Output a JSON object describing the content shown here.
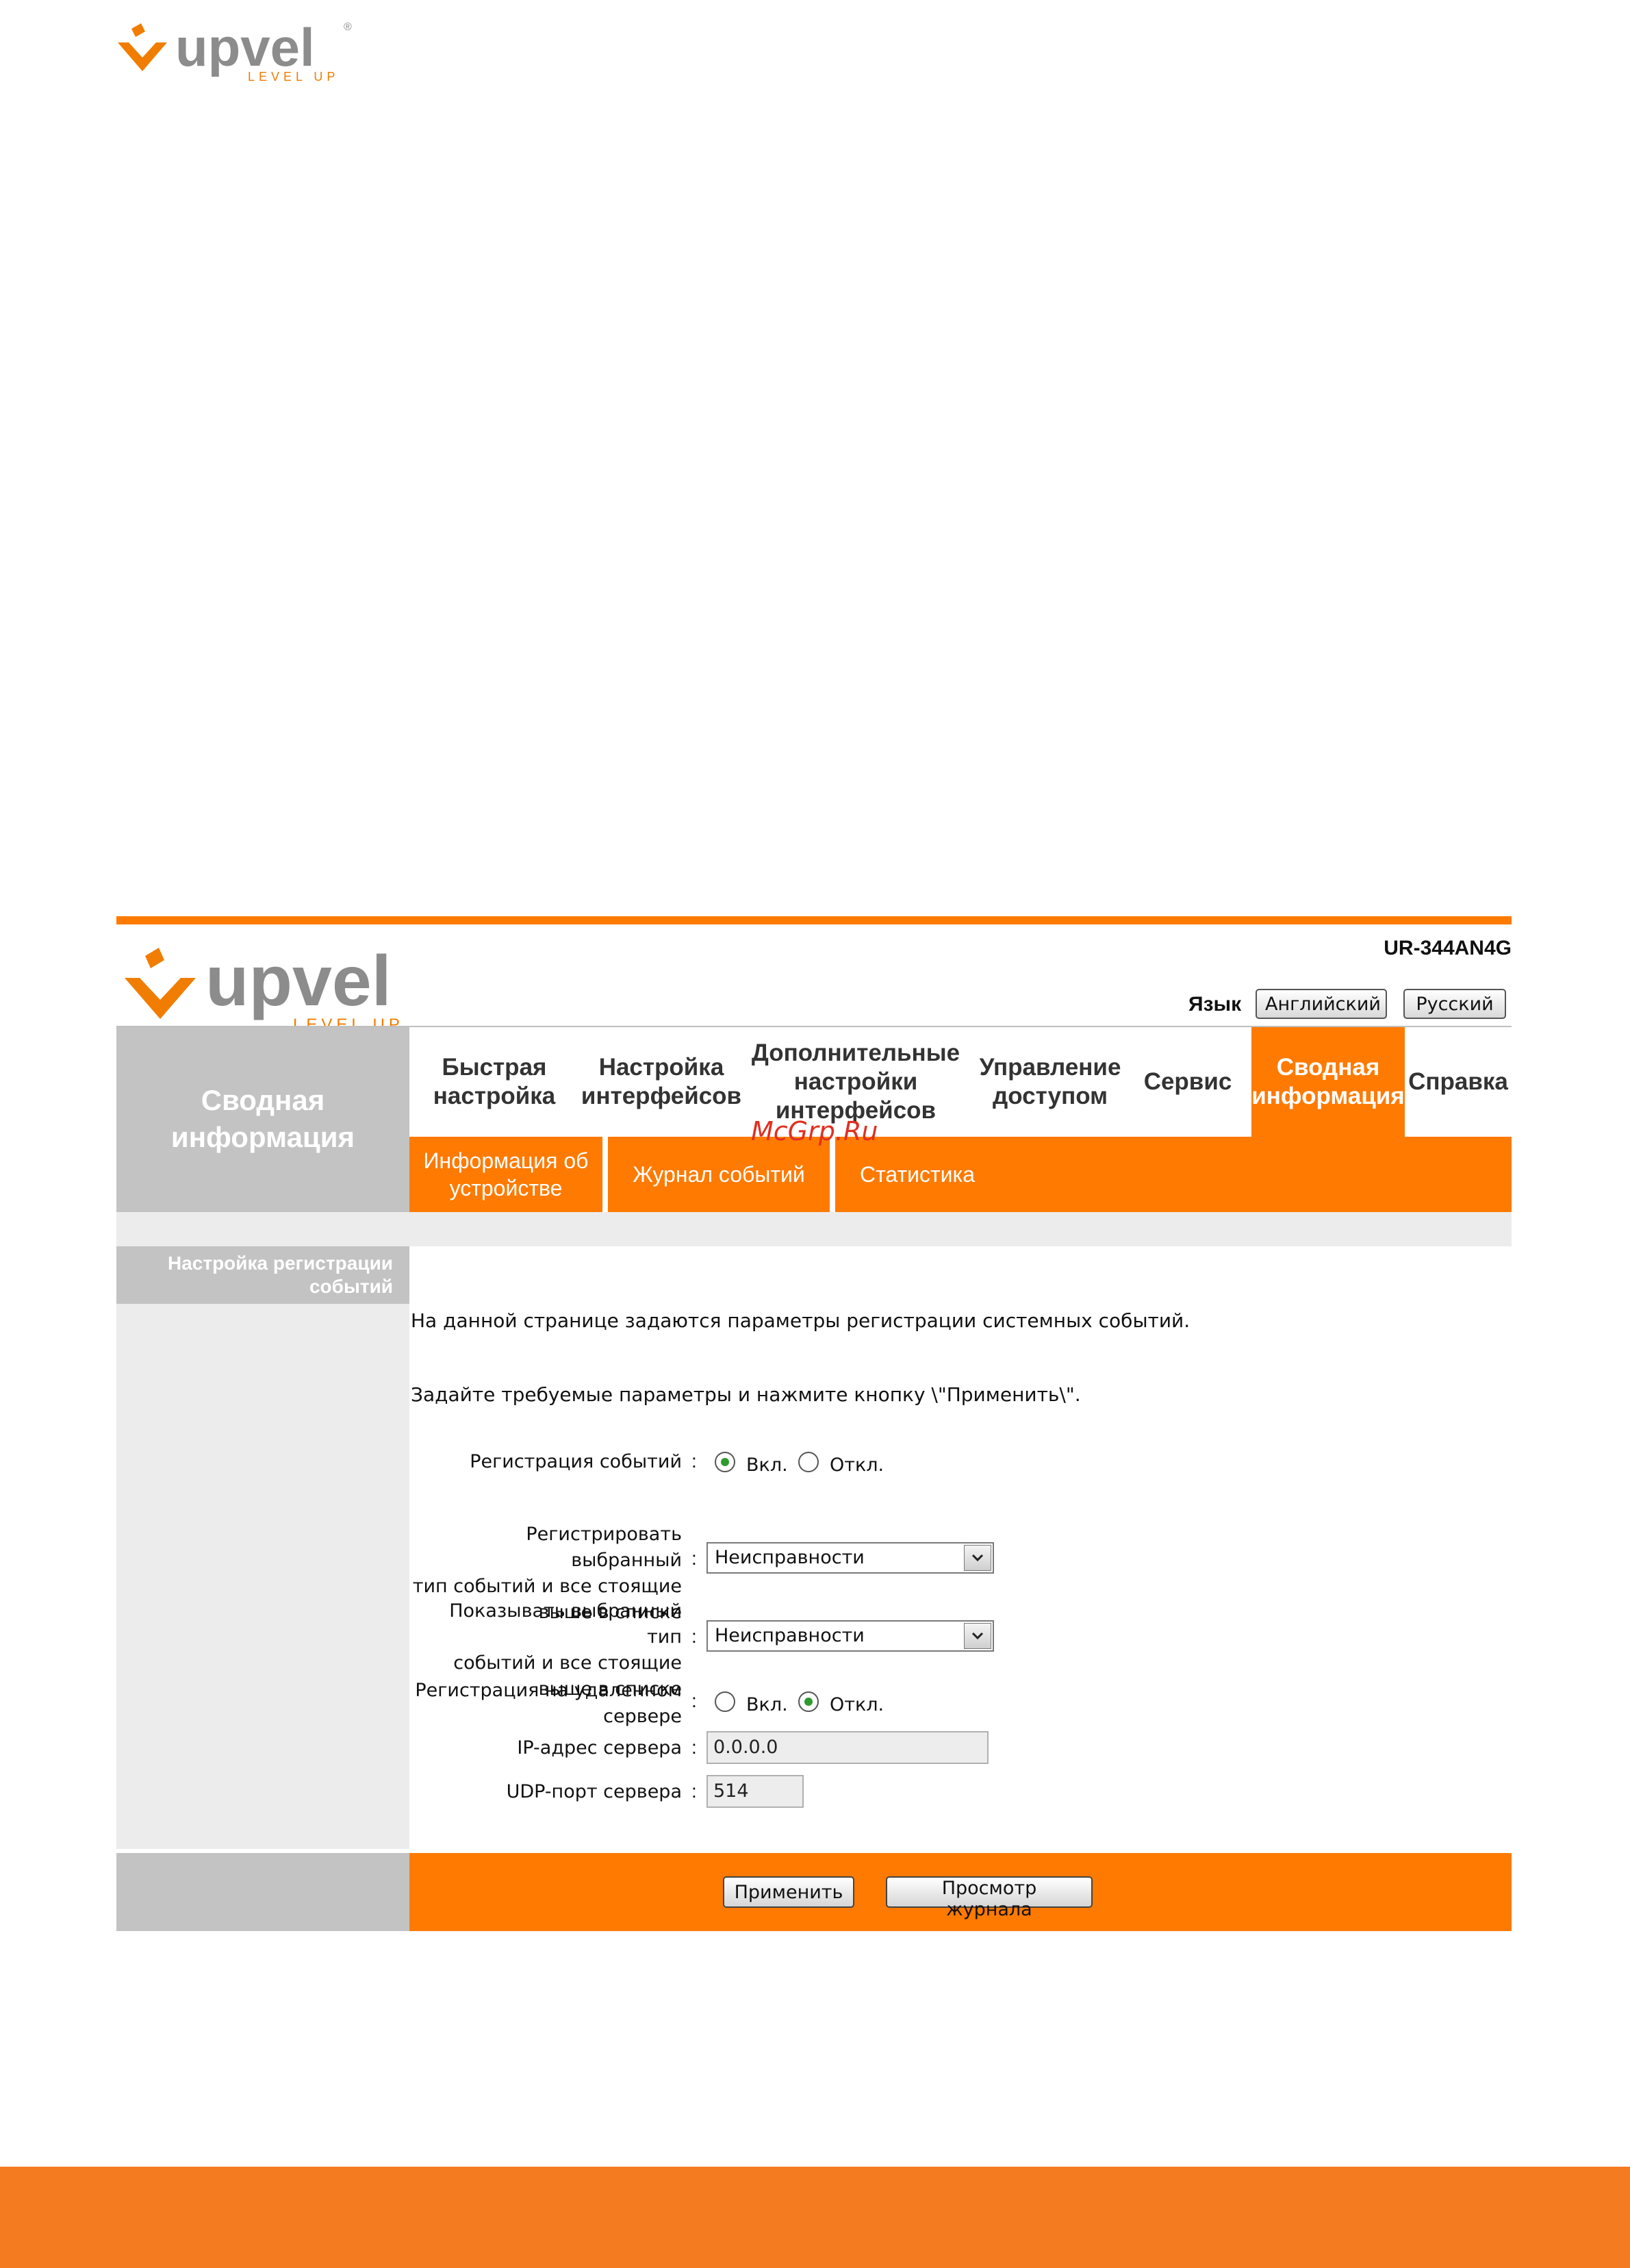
{
  "brand": {
    "name": "upvel",
    "tagline": "LEVEL UP",
    "registered": "®",
    "colors": {
      "accent": "#ff7a00",
      "gray": "#c3c3c3",
      "logo_gray": "#8c8c8c"
    }
  },
  "header": {
    "model": "UR-344AN4G",
    "language_label": "Язык",
    "lang_english": "Английский",
    "lang_russian": "Русский"
  },
  "left_panel": {
    "title_line1": "Сводная",
    "title_line2": "информация"
  },
  "nav": {
    "quick_setup": [
      "Быстрая",
      "настройка"
    ],
    "interfaces": [
      "Настройка",
      "интерфейсов"
    ],
    "advanced": [
      "Дополнительные",
      "настройки",
      "интерфейсов"
    ],
    "access": [
      "Управление",
      "доступом"
    ],
    "service": "Сервис",
    "summary": [
      "Сводная",
      "информация"
    ],
    "help": "Справка"
  },
  "subnav": {
    "device_info": [
      "Информация об",
      "устройстве"
    ],
    "event_log": "Журнал событий",
    "statistics": "Статистика"
  },
  "section": {
    "title_line1": "Настройка регистрации",
    "title_line2": "событий"
  },
  "content": {
    "intro": "На данной странице задаются параметры регистрации системных событий.",
    "instruction": "Задайте требуемые параметры и нажмите кнопку \\\"Применить\\\".",
    "logging": {
      "label": "Регистрация событий",
      "on": "Вкл.",
      "off": "Откл."
    },
    "log_level": {
      "label": [
        "Регистрировать выбранный",
        "тип событий и все стоящие",
        "выше в списке"
      ],
      "value": "Неисправности"
    },
    "display_level": {
      "label": [
        "Показывать выбранный тип",
        "событий и все стоящие",
        "выше в списке"
      ],
      "value": "Неисправности"
    },
    "remote": {
      "label": [
        "Регистрация на удаленном",
        "сервере"
      ],
      "on": "Вкл.",
      "off": "Откл."
    },
    "server_ip": {
      "label": "IP-адрес сервера",
      "value": "0.0.0.0"
    },
    "server_port": {
      "label": "UDP-порт сервера",
      "value": "514"
    },
    "colon": ":"
  },
  "footer": {
    "apply": "Применить",
    "view_log": "Просмотр журнала"
  },
  "watermark": "McGrp.Ru"
}
